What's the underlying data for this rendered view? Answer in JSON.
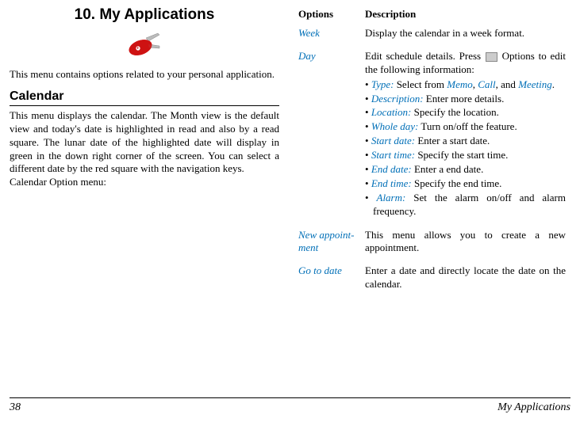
{
  "chapter": {
    "title": "10. My Applications",
    "intro": "This menu contains options related to your personal application."
  },
  "section": {
    "heading": "Calendar",
    "body": "This menu displays the calendar. The Month view is the default view and today's date is highlighted in read and also by a read square. The lunar date of the highlighted date will display in green in the down right corner of the screen. You can select a different date by the red square with the navigation keys.",
    "trailer": "Calendar Option menu:"
  },
  "table": {
    "headers": {
      "options": "Options",
      "description": "Description"
    },
    "rows": {
      "week": {
        "name": "Week",
        "desc": "Display the calendar in a week format."
      },
      "day": {
        "name": "Day",
        "lead1": "Edit schedule details. Press ",
        "lead2": " Options to edit the following information:",
        "bullets": {
          "type": {
            "kw": "Type:",
            "rest_a": " Select from ",
            "kw2": "Memo",
            "sep1": ", ",
            "kw3": "Call",
            "sep2": ", and ",
            "kw4": "Meeting",
            "tail": "."
          },
          "description": {
            "kw": "Description:",
            "rest": " Enter more details."
          },
          "location": {
            "kw": "Location:",
            "rest": " Specify the location."
          },
          "wholeday": {
            "kw": "Whole day:",
            "rest": " Turn on/off the feature."
          },
          "startdate": {
            "kw": "Start date:",
            "rest": " Enter a start date."
          },
          "starttime": {
            "kw": "Start time:",
            "rest": " Specify the start time."
          },
          "enddate": {
            "kw": "End date:",
            "rest": " Enter a end date."
          },
          "endtime": {
            "kw": "End time:",
            "rest": " Specify the end time."
          },
          "alarm": {
            "kw": "Alarm:",
            "rest": " Set the alarm on/off and alarm frequency."
          }
        }
      },
      "newappt": {
        "name": "New appoint-ment",
        "desc": "This menu allows you to create a new appointment."
      },
      "gotodate": {
        "name": "Go to date",
        "desc": "Enter a date and directly locate the date on the calendar."
      }
    }
  },
  "footer": {
    "page": "38",
    "label": "My Applications"
  }
}
